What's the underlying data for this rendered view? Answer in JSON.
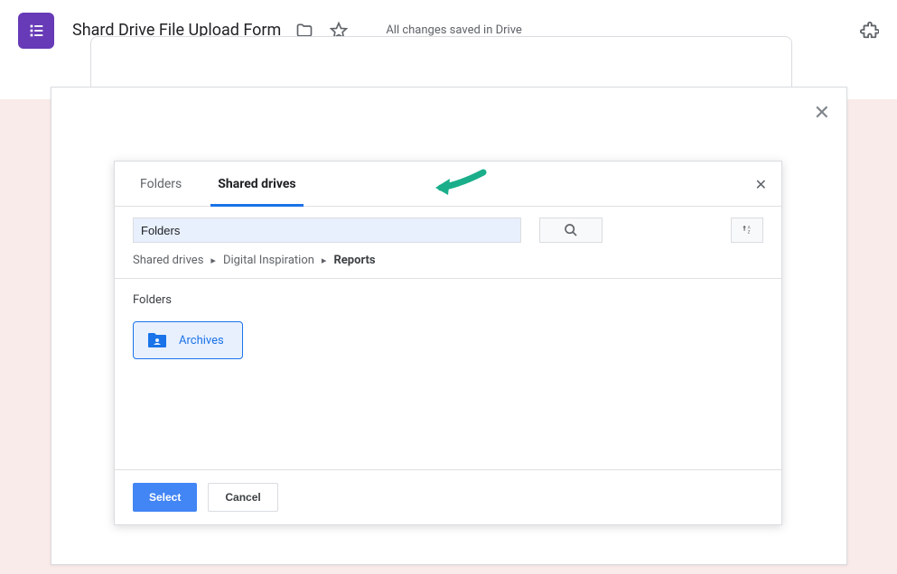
{
  "header": {
    "title": "Shard Drive File Upload Form",
    "save_status": "All changes saved in Drive"
  },
  "picker": {
    "tabs": {
      "folders": "Folders",
      "shared_drives": "Shared drives"
    },
    "search": {
      "value": "Folders"
    },
    "breadcrumb": {
      "root": "Shared drives",
      "level1": "Digital Inspiration",
      "current": "Reports"
    },
    "section_label": "Folders",
    "folder": {
      "name": "Archives"
    },
    "buttons": {
      "select": "Select",
      "cancel": "Cancel"
    }
  }
}
